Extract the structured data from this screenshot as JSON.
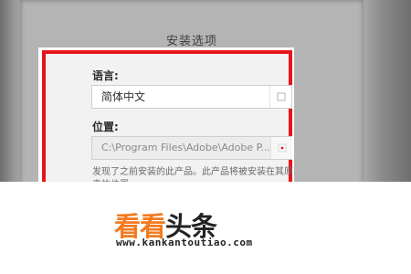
{
  "dialog": {
    "title": "安装选项",
    "language": {
      "label": "语言:",
      "value": "简体中文"
    },
    "location": {
      "label": "位置:",
      "value": "C:\\Program Files\\Adobe\\Adobe P..."
    },
    "note": "发现了之前安装的此产品。此产品将被安装在其原来的位置。"
  },
  "watermark": {
    "brand_part1": "看看",
    "brand_part2": "头条",
    "url": "www.kankantoutiao.com",
    "brand_color": "#f47a1f"
  },
  "highlight_color": "#e8141c"
}
